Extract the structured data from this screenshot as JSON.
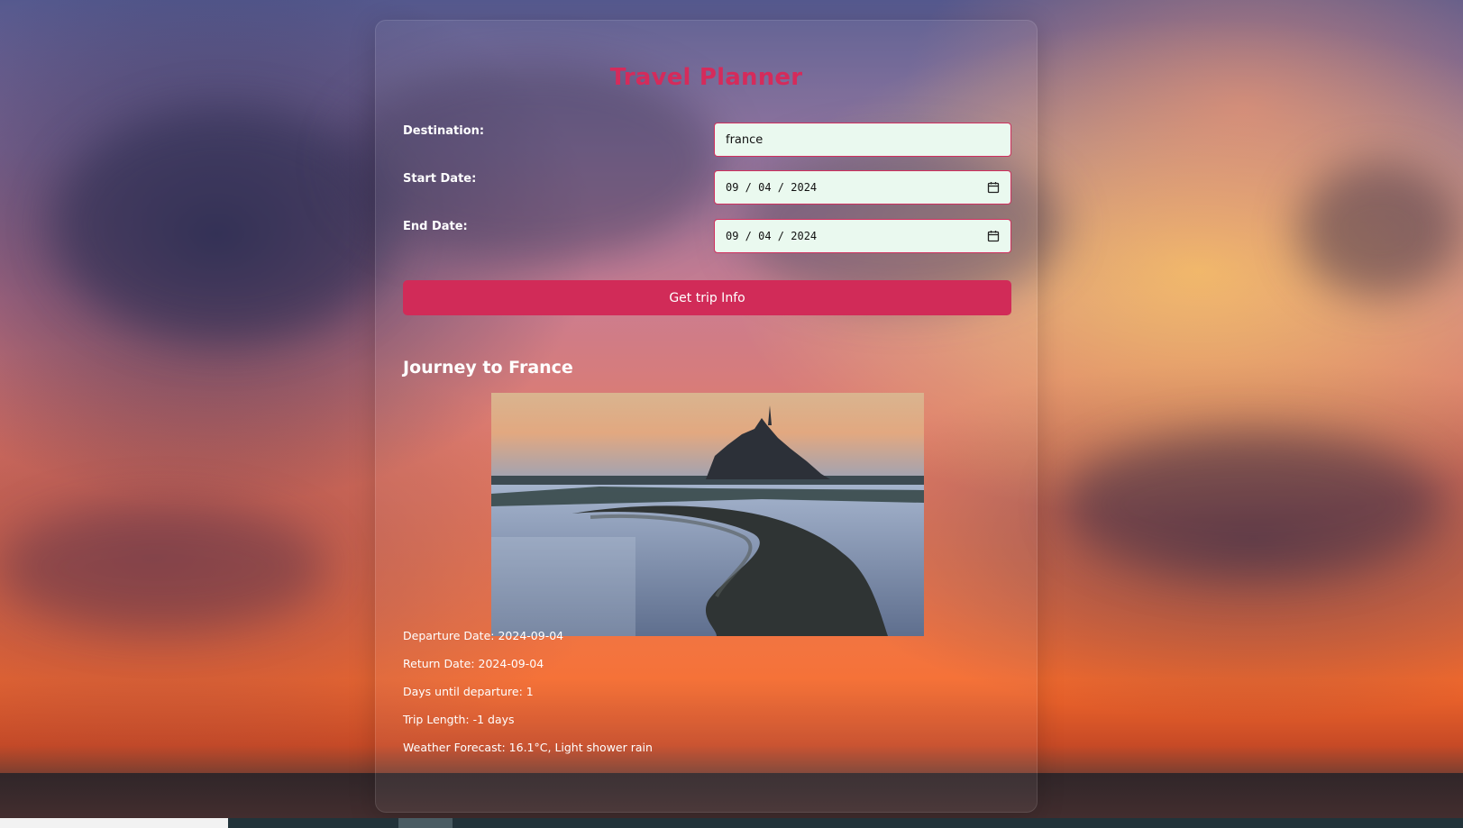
{
  "app": {
    "title": "Travel Planner"
  },
  "form": {
    "destination_label": "Destination:",
    "destination_value": "france",
    "start_date_label": "Start Date:",
    "start_date_value": "09 / 04 / 2024",
    "end_date_label": "End Date:",
    "end_date_value": "09 / 04 / 2024",
    "submit_label": "Get trip Info"
  },
  "result": {
    "heading": "Journey to France",
    "image_icon": "mont-saint-michel-photo",
    "departure": "Departure Date: 2024-09-04",
    "return": "Return Date: 2024-09-04",
    "days_until": "Days until departure: 1",
    "trip_length": "Trip Length: -1 days",
    "weather": "Weather Forecast: 16.1°C, Light shower rain"
  },
  "colors": {
    "accent": "#d12b58",
    "input_bg": "#eaf9ef"
  },
  "icons": {
    "calendar": "calendar-icon"
  }
}
